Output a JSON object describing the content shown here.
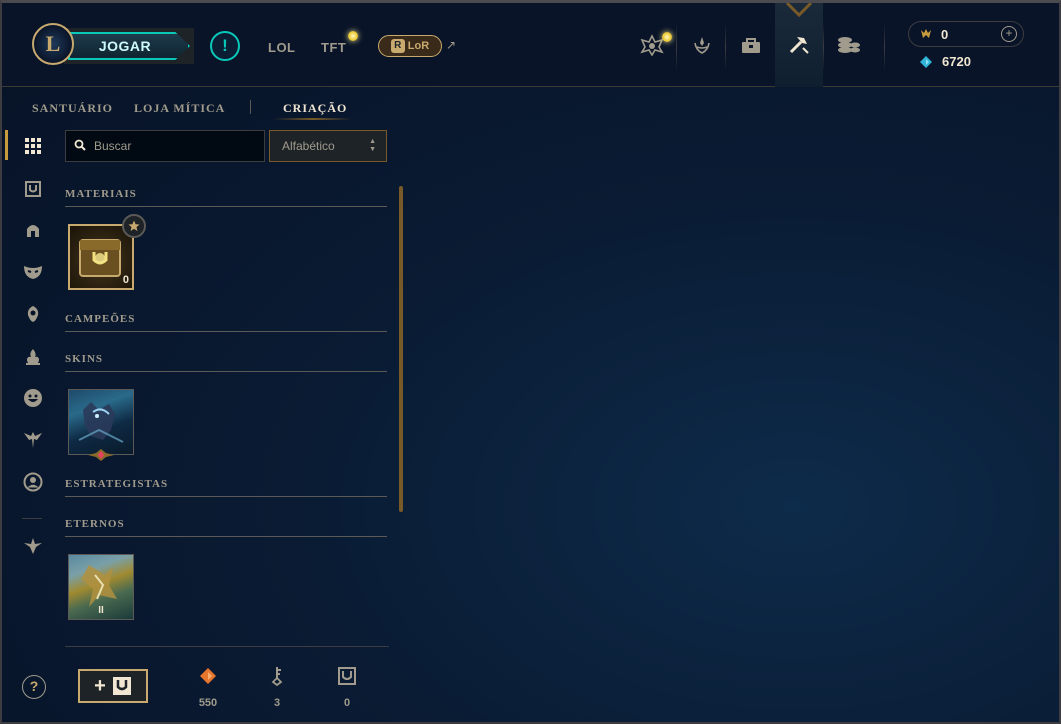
{
  "topnav": {
    "logo_letter": "L",
    "play_label": "JOGAR",
    "alert_label": "!",
    "lol_label": "LOL",
    "tft_label": "TFT",
    "lor_badge": "R",
    "lor_label": "LoR",
    "external_arrow": "↗",
    "currency": {
      "rp": "0",
      "blue_essence": "6720",
      "add_label": "+"
    }
  },
  "subnav": {
    "tabs": [
      {
        "label": "SANTUÁRIO"
      },
      {
        "label": "LOJA MÍTICA"
      },
      {
        "label": "CRIAÇÃO",
        "active": true
      }
    ]
  },
  "search": {
    "placeholder": "Buscar"
  },
  "sort": {
    "selected": "Alfabético"
  },
  "loot": {
    "sections": [
      {
        "label": "MATERIAIS"
      },
      {
        "label": "CAMPEÕES"
      },
      {
        "label": "SKINS"
      },
      {
        "label": "ESTRATEGISTAS"
      },
      {
        "label": "ETERNOS"
      }
    ],
    "chest_count": "0",
    "eternal_series": "II"
  },
  "help_label": "?",
  "footer": {
    "open_chest_label": "+",
    "orange_essence": "550",
    "keys": "3",
    "chests": "0"
  },
  "colors": {
    "gold": "#c8aa6e",
    "teal": "#0ac8b9",
    "text": "#a09b8c",
    "background": "#0a1428",
    "orange_essence": "#e8772e",
    "blue_essence": "#2fb4d8"
  },
  "icons": {
    "rail": [
      "grid-icon",
      "chest-icon",
      "helmet-icon",
      "mask-icon",
      "ward-icon",
      "emote-flame-icon",
      "emote-icon",
      "tft-icon",
      "profile-icon",
      "eternal-icon"
    ],
    "nav": [
      "champions-icon",
      "honor-icon",
      "store-bag-icon",
      "loot-crafting-icon",
      "coins-icon"
    ]
  }
}
